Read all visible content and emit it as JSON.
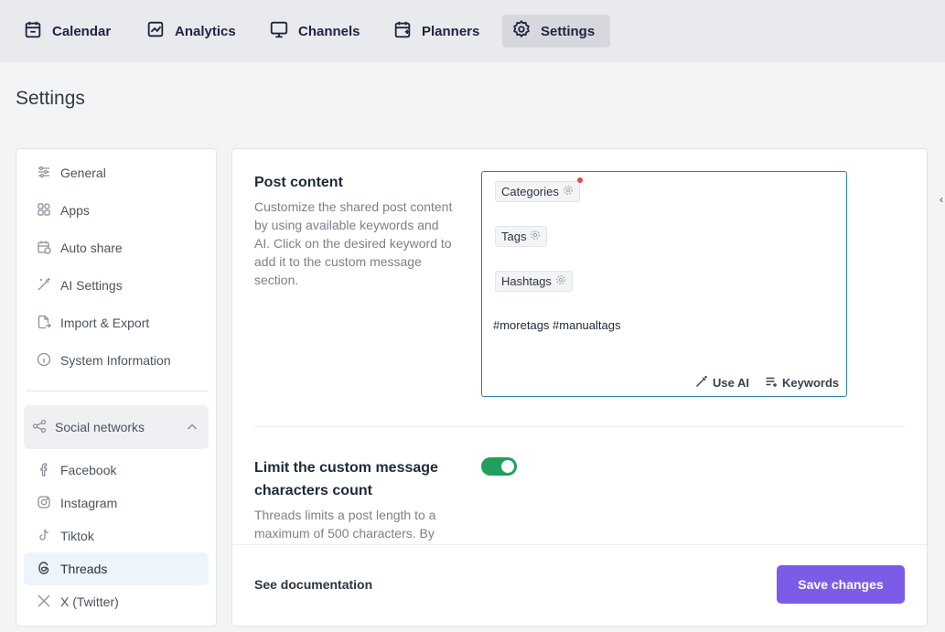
{
  "topnav": {
    "tabs": [
      {
        "label": "Calendar",
        "icon": "calendar-icon"
      },
      {
        "label": "Analytics",
        "icon": "analytics-icon"
      },
      {
        "label": "Channels",
        "icon": "monitor-icon"
      },
      {
        "label": "Planners",
        "icon": "calendar-plus-icon"
      },
      {
        "label": "Settings",
        "icon": "gear-icon",
        "active": true
      }
    ]
  },
  "page": {
    "title": "Settings"
  },
  "sidebar": {
    "items": [
      {
        "label": "General",
        "icon": "sliders-icon"
      },
      {
        "label": "Apps",
        "icon": "apps-grid-icon"
      },
      {
        "label": "Auto share",
        "icon": "calendar-clock-icon"
      },
      {
        "label": "AI Settings",
        "icon": "magic-wand-icon"
      },
      {
        "label": "Import & Export",
        "icon": "file-export-icon"
      },
      {
        "label": "System Information",
        "icon": "info-icon"
      }
    ],
    "group": {
      "label": "Social networks",
      "icon": "share-nodes-icon",
      "expanded": true
    },
    "networks": [
      {
        "label": "Facebook",
        "icon": "facebook-icon"
      },
      {
        "label": "Instagram",
        "icon": "instagram-icon"
      },
      {
        "label": "Tiktok",
        "icon": "tiktok-icon"
      },
      {
        "label": "Threads",
        "icon": "threads-icon",
        "active": true
      },
      {
        "label": "X (Twitter)",
        "icon": "x-twitter-icon"
      }
    ]
  },
  "post_content": {
    "title": "Post content",
    "description": "Customize the shared post content by using available keywords and AI. Click on the desired keyword to add it to the custom message section.",
    "chips": [
      "Categories",
      "Tags",
      "Hashtags"
    ],
    "text": "#moretags #manualtags",
    "use_ai_label": "Use AI",
    "keywords_label": "Keywords"
  },
  "limit": {
    "title": "Limit the custom message characters count",
    "description": "Threads limits a post length to a maximum of 500 characters. By",
    "enabled": true
  },
  "footer": {
    "doc_link": "See documentation",
    "save_label": "Save changes"
  },
  "colors": {
    "accent": "#7c5ce6",
    "toggle_on": "#22a05b",
    "editor_border": "#2f7ab8",
    "notification_dot": "#ef4444"
  }
}
